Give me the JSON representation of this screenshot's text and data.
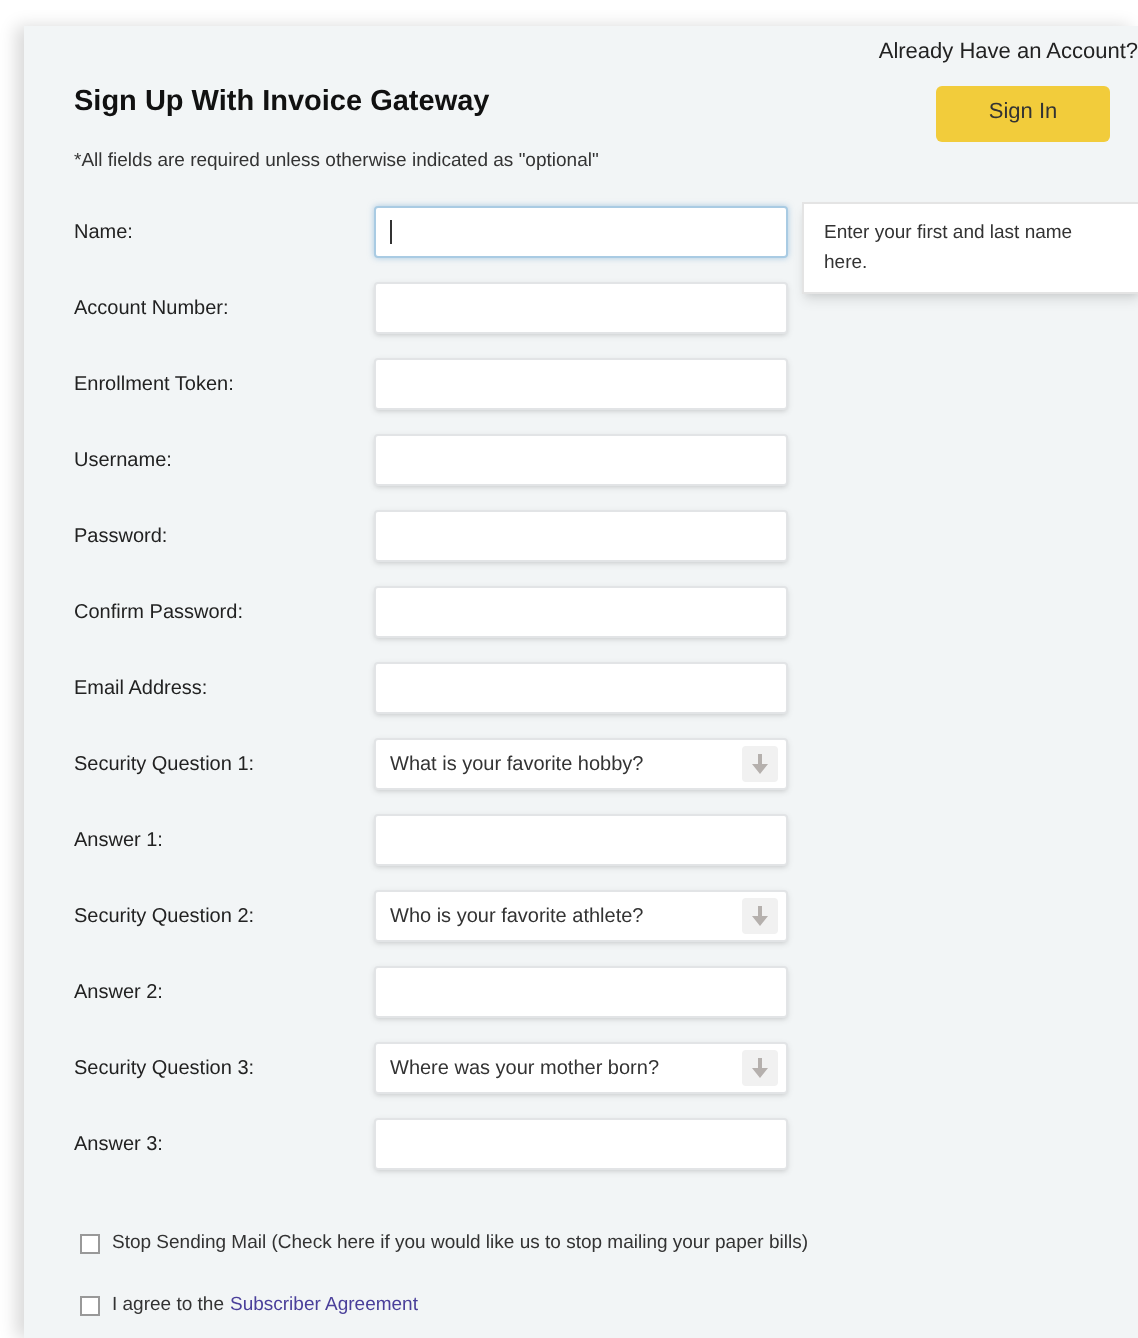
{
  "account_prompt": {
    "text": "Already Have an Account?",
    "button": "Sign In"
  },
  "title": "Sign Up With Invoice Gateway",
  "note": "*All fields are required unless otherwise indicated as \"optional\"",
  "fields": [
    {
      "label": "Name:",
      "kind": "text",
      "focused": true,
      "tooltip": "Enter your first and last name here."
    },
    {
      "label": "Account Number:",
      "kind": "text",
      "focused": false
    },
    {
      "label": "Enrollment Token:",
      "kind": "text",
      "focused": false
    },
    {
      "label": "Username:",
      "kind": "text",
      "focused": false
    },
    {
      "label": "Password:",
      "kind": "text",
      "focused": false
    },
    {
      "label": "Confirm Password:",
      "kind": "text",
      "focused": false
    },
    {
      "label": "Email Address:",
      "kind": "text",
      "focused": false
    },
    {
      "label": "Security Question 1:",
      "kind": "select",
      "value": "What is your favorite hobby?"
    },
    {
      "label": "Answer 1:",
      "kind": "text",
      "focused": false
    },
    {
      "label": "Security Question 2:",
      "kind": "select",
      "value": "Who is your favorite athlete?"
    },
    {
      "label": "Answer 2:",
      "kind": "text",
      "focused": false
    },
    {
      "label": "Security Question 3:",
      "kind": "select",
      "value": "Where was your mother born?"
    },
    {
      "label": "Answer 3:",
      "kind": "text",
      "focused": false
    }
  ],
  "checkboxes": [
    {
      "label": "Stop Sending Mail (Check here if you would like us to stop mailing your paper bills)",
      "checked": false
    },
    {
      "label": "I agree to the",
      "link": "Subscriber Agreement",
      "checked": false
    }
  ]
}
